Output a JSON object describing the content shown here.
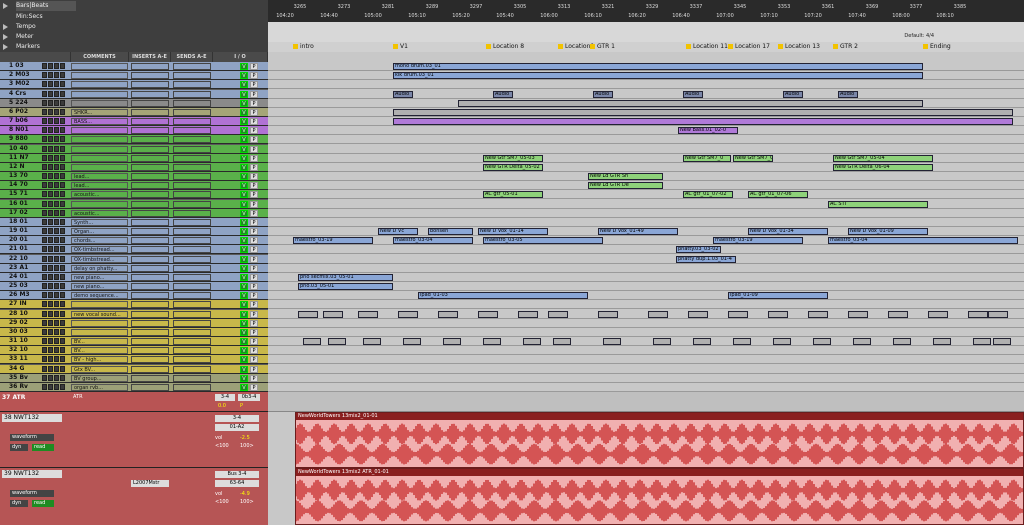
{
  "rulers": [
    "Bars|Beats",
    "Min:Secs",
    "Tempo",
    "Meter",
    "Markers"
  ],
  "column_headers": {
    "comments": "COMMENTS",
    "inserts": "INSERTS A-E",
    "sends": "SENDS A-E",
    "io": "I / O"
  },
  "default_meter": "Default: 4/4",
  "bars": [
    "3265",
    "3273",
    "3281",
    "3289",
    "3297",
    "3305",
    "3313",
    "3321",
    "3329",
    "3337",
    "3345",
    "3353",
    "3361",
    "3369",
    "3377",
    "3385"
  ],
  "times": [
    "104:20",
    "104:40",
    "105:00",
    "105:10",
    "105:20",
    "105:40",
    "106:00",
    "106:10",
    "106:20",
    "106:40",
    "107:00",
    "107:10",
    "107:20",
    "107:40",
    "108:00",
    "108:10"
  ],
  "markers": [
    "intro",
    "V1",
    "Location 8",
    "Location9",
    "GTR 1",
    "Location 11",
    "Location 17",
    "Location 13",
    "GTR 2",
    "Ending"
  ],
  "tracks": [
    {
      "name": "1 03",
      "comment": "",
      "color": "#8fa3c4"
    },
    {
      "name": "2 M03",
      "comment": "",
      "color": "#8fa3c4"
    },
    {
      "name": "3 M02",
      "comment": "",
      "color": "#8fa3c4"
    },
    {
      "name": "4 Crs",
      "comment": "",
      "color": "#8fa3c4"
    },
    {
      "name": "5 224",
      "comment": "",
      "color": "#8a8a8a"
    },
    {
      "name": "6 P02",
      "comment": "SHKR...",
      "color": "#a5a577"
    },
    {
      "name": "7 b06",
      "comment": "BASS...",
      "color": "#b072d4"
    },
    {
      "name": "8 N01",
      "comment": "",
      "color": "#b072d4"
    },
    {
      "name": "9 880",
      "comment": "",
      "color": "#5ab04a"
    },
    {
      "name": "10 40",
      "comment": "",
      "color": "#5ab04a"
    },
    {
      "name": "11 N7",
      "comment": "",
      "color": "#5ab04a"
    },
    {
      "name": "12 N",
      "comment": "",
      "color": "#5ab04a"
    },
    {
      "name": "13 70",
      "comment": "lead...",
      "color": "#5ab04a"
    },
    {
      "name": "14 70",
      "comment": "lead...",
      "color": "#5ab04a"
    },
    {
      "name": "15 71",
      "comment": "acoustic...",
      "color": "#5ab04a"
    },
    {
      "name": "16 01",
      "comment": "",
      "color": "#5ab04a"
    },
    {
      "name": "17 02",
      "comment": "acoustic...",
      "color": "#5ab04a"
    },
    {
      "name": "18 01",
      "comment": "Synth...",
      "color": "#8fa3c4"
    },
    {
      "name": "19 01",
      "comment": "Organ...",
      "color": "#8fa3c4"
    },
    {
      "name": "20 01",
      "comment": "chords...",
      "color": "#8fa3c4"
    },
    {
      "name": "21 01",
      "comment": "OX-timbstread...",
      "color": "#8fa3c4"
    },
    {
      "name": "22 10",
      "comment": "OX-timbstread...",
      "color": "#8fa3c4"
    },
    {
      "name": "23 A1",
      "comment": "delay on phatty...",
      "color": "#8fa3c4"
    },
    {
      "name": "24 01",
      "comment": "new piano...",
      "color": "#8fa3c4"
    },
    {
      "name": "25 03",
      "comment": "new piano...",
      "color": "#8fa3c4"
    },
    {
      "name": "26 M3",
      "comment": "demo sequence...",
      "color": "#8fa3c4"
    },
    {
      "name": "27 IN",
      "comment": "",
      "color": "#c8b84a"
    },
    {
      "name": "28 10",
      "comment": "new vocal sound...",
      "color": "#c8b84a"
    },
    {
      "name": "29 02",
      "comment": "",
      "color": "#c8b84a"
    },
    {
      "name": "30 03",
      "comment": "",
      "color": "#c8b84a"
    },
    {
      "name": "31 10",
      "comment": "BV...",
      "color": "#c8b84a"
    },
    {
      "name": "32 10",
      "comment": "BV...",
      "color": "#c8b84a"
    },
    {
      "name": "33 11",
      "comment": "BV - high...",
      "color": "#c8b84a"
    },
    {
      "name": "34 G",
      "comment": "Gtx BV...",
      "color": "#c8b84a"
    },
    {
      "name": "35 Bv",
      "comment": "BV group...",
      "color": "#9ca078"
    },
    {
      "name": "36 Rv",
      "comment": "organ rvb...",
      "color": "#9ca078"
    },
    {
      "name": "37 ATR",
      "comment": "ATR",
      "color": "#c85c5c"
    }
  ],
  "big_tracks": [
    {
      "name": "38 NWT132",
      "mode": "waveform",
      "dyn": "dyn",
      "read": "read",
      "io_in": "3-4",
      "io_out": "01-A2",
      "vol": "-2.5",
      "pan": "<100",
      "pan2": "100>",
      "clip": "NewWorldTowers 13mix2_01-01"
    },
    {
      "name": "39 NWT132",
      "mode": "waveform",
      "dyn": "dyn",
      "read": "read",
      "io_in": "Bus 3-4",
      "io_out": "63-64",
      "insert": "L2007Mstr",
      "vol": "-4.9",
      "pan": "<100",
      "pan2": "100>",
      "clip": "NewWorldTowers 13mix2 ATR_01-01"
    }
  ],
  "atr_io": {
    "in": "3-4",
    "out": "0b3-4",
    "vol": "0.0",
    "p": "P"
  },
  "clips": {
    "row1": [
      "mono drum.03_01"
    ],
    "row2": [
      "kik drum.03_01"
    ],
    "audio": [
      "Audio",
      "Audio",
      "Audio",
      "Audio",
      "Audio",
      "Audio"
    ],
    "bass": [
      "New Bass.01_02-0"
    ],
    "gtr": [
      "New Gtr SM7_05-03",
      "New GTR Delta_05-02",
      "New Gtr SM7_0",
      "New Gtr SM7_05-05",
      "New Gtr SM7_05-04",
      "New GTR Delta_06-04"
    ],
    "lead": [
      "New Ld GTR Sh",
      "New Ld GTR De",
      "AC gtr_05-01",
      "AC gtr_01_07-02",
      "AC gtr_01_07-06",
      "AC STI"
    ],
    "vox": [
      "New D Vc",
      "bonsen",
      "bonsen",
      "New D Vox_01-14",
      "New D Vox_01-49",
      "New D Vox_01-34",
      "New D Vox_01-09"
    ],
    "maestro": [
      "maestro_03-19",
      "maestro_03-04",
      "maestro_03-05",
      "maestro_03-19",
      "maestro_03-04"
    ],
    "phatty": [
      "phatty.03_03-02",
      "phatty dup.1.03_01-4"
    ],
    "piano": [
      "pno secmix.03_05-01",
      "pno.03_05-01"
    ],
    "ipad": [
      "ipad_01-03",
      "ipa",
      "ipad_01-09"
    ]
  }
}
